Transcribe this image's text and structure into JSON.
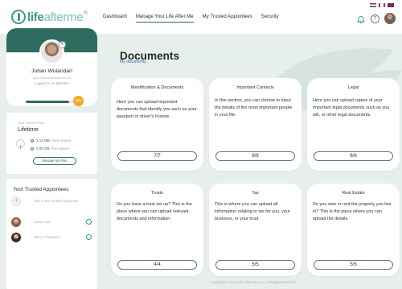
{
  "brand": {
    "life": "life",
    "afterme": "afterme",
    "reg": "®"
  },
  "nav": [
    {
      "label": "Dashboard",
      "active": false
    },
    {
      "label": "Manage Your Life After Me",
      "active": true
    },
    {
      "label": "My Trusted Appointees",
      "active": false
    },
    {
      "label": "Security",
      "active": false
    }
  ],
  "topbar": {
    "help": "?"
  },
  "profile": {
    "name": "Johan Wulandari",
    "subtitle": "johan.wulandari@lifeafterme.com",
    "status": "Logged in as Member",
    "edit_icon": "✎",
    "progress_percent": 90,
    "progress_label": "90%"
  },
  "plan": {
    "caption": "Your Current Plan",
    "name": "Lifetime",
    "used_value": "1.13 MB",
    "used_label": "Used Space",
    "free_value": "0.00 GB",
    "free_label": "Free Space",
    "button": "Manage My Plan"
  },
  "appointees": {
    "title": "Your Trusted Appointees",
    "add_label": "Add a New Trusted Appointee",
    "people": [
      {
        "name": "Sarah Jane",
        "status": "active"
      },
      {
        "name": "Nancy Thompson",
        "status": "active"
      }
    ]
  },
  "page": {
    "title": "Documents",
    "breadcrumb": "My documents"
  },
  "cards": [
    {
      "title": "Identification & Documents",
      "description": "Here you can upload important documents that identify you such as your passport or driver's license.",
      "count": "7/7"
    },
    {
      "title": "Important Contacts",
      "description": "In this section, you can choose to input the details of the most important people in your life.",
      "count": "8/8"
    },
    {
      "title": "Legal",
      "description": "Here you can upload copies of your important legal documents such as you will, or other legal documents.",
      "count": "6/6"
    },
    {
      "title": "Trusts",
      "description": "Do you have a trust set up? This is the place where you can upload relevant documents and information.",
      "count": "4/4"
    },
    {
      "title": "Tax",
      "description": "This is where you can upload all information relating to tax for you, your business, or your trust.",
      "count": "5/5"
    },
    {
      "title": "Real Estate",
      "description": "Do you own or rent the property you live in? This is the place where you can upload the details.",
      "count": "5/5"
    }
  ],
  "footer": "Copyright © 2024 Life After Me U.S., All Rights Reserved",
  "colors": {
    "brand": "#3f9a86",
    "primary": "#2f6b5f",
    "background": "#e6efe9",
    "badge": "#f3a623",
    "online": "#27a35a",
    "link": "#3b67b8"
  }
}
